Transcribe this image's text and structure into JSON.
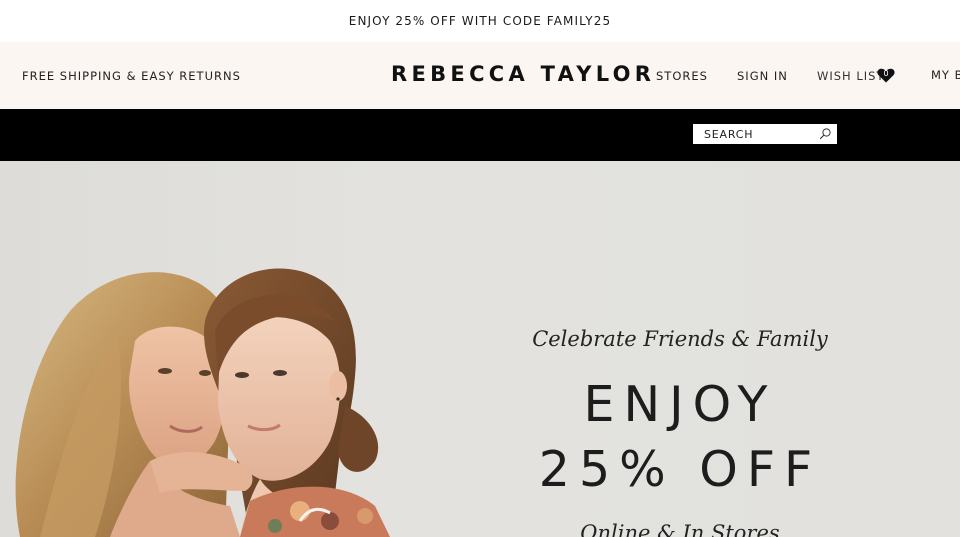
{
  "promo": {
    "text": "ENJOY 25% OFF WITH CODE FAMILY25"
  },
  "header": {
    "shipping": "FREE SHIPPING & EASY RETURNS",
    "logo": "REBECCA TAYLOR",
    "nav": {
      "stores": "STORES",
      "sign_in": "SIGN IN",
      "wish_list": "WISH LIST",
      "wish_count": "0",
      "my_bag": "MY B"
    }
  },
  "search": {
    "placeholder": "SEARCH"
  },
  "hero": {
    "tagline": "Celebrate Friends & Family",
    "headline_line1": "ENJOY",
    "headline_line2": "25% OFF",
    "subline": "Online & In Stores"
  },
  "colors": {
    "header_bg": "#fcf6f3",
    "navbar_bg": "#000000",
    "hero_bg": "#e2e1dd"
  }
}
